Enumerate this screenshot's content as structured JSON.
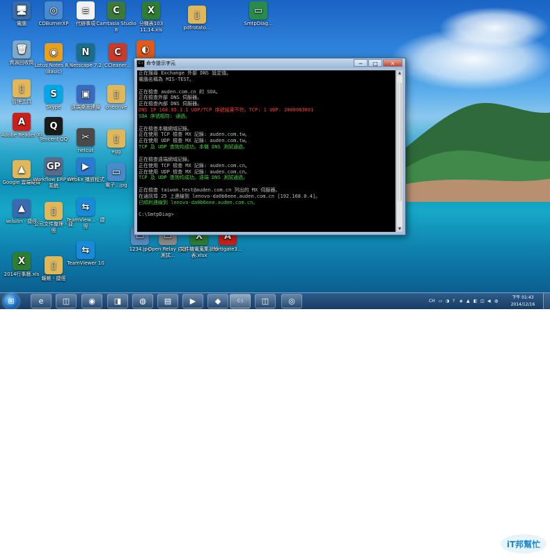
{
  "desktop": {
    "icons": [
      {
        "label": "電腦",
        "symbol": "🖥",
        "bg": "#3b6ea8"
      },
      {
        "label": "CDBurnerXP",
        "symbol": "◎",
        "bg": "#4a8bd0"
      },
      {
        "label": "代辦事項",
        "symbol": "≡",
        "bg": "#f2f2f2"
      },
      {
        "label": "Camtasia Studio 8",
        "symbol": "C",
        "bg": "#3c7a3c"
      },
      {
        "label": "分機表103 11.14.xls",
        "symbol": "X",
        "bg": "#2e7d32"
      },
      {
        "label": "pdfrotato...",
        "symbol": "▯",
        "bg": "#e0b85a"
      },
      {
        "label": "SmtpDiag...",
        "symbol": "▭",
        "bg": "#2a8a4a"
      },
      {
        "label": "資源回收筒",
        "symbol": "🗑",
        "bg": "#7fa8c8"
      },
      {
        "label": "Lotus Notes 8.5 (Basic)",
        "symbol": "◉",
        "bg": "#e8a020"
      },
      {
        "label": "Netscape 7.2",
        "symbol": "N",
        "bg": "#1b6e8a"
      },
      {
        "label": "CCleaner...",
        "symbol": "C",
        "bg": "#c83a2a"
      },
      {
        "label": "Sp...",
        "symbol": "◐",
        "bg": "#e05a1a"
      },
      {
        "label": "管理工具",
        "symbol": "▯",
        "bg": "#e0b85a"
      },
      {
        "label": "Skype",
        "symbol": "S",
        "bg": "#00a8e8"
      },
      {
        "label": "遠端桌面連線",
        "symbol": "▣",
        "bg": "#3a6ac0"
      },
      {
        "label": "onedrive",
        "symbol": "▯",
        "bg": "#e0b85a"
      },
      {
        "label": "Adobe Reader XI",
        "symbol": "A",
        "bg": "#c8201a"
      },
      {
        "label": "Tencent QQ",
        "symbol": "Q",
        "bg": "#1a1a1a"
      },
      {
        "label": "netcut",
        "symbol": "✂",
        "bg": "#4a4a4a"
      },
      {
        "label": "egg",
        "symbol": "▯",
        "bg": "#e0b85a"
      },
      {
        "label": "Google 雲端硬碟",
        "symbol": "▲",
        "bg": "#e0b85a"
      },
      {
        "label": "Workflow ERP GP 系統",
        "symbol": "GP",
        "bg": "#5a6a8a"
      },
      {
        "label": "WebEx 播放程式",
        "symbol": "▶",
        "bg": "#2a7ad0"
      },
      {
        "label": "電子...jpg",
        "symbol": "▭",
        "bg": "#4a8ac8"
      },
      {
        "label": "wilsilin - 捷徑",
        "symbol": "▲",
        "bg": "#3a6ab0"
      },
      {
        "label": "公司文件整理 - 捷徑",
        "symbol": "▯",
        "bg": "#e0b85a"
      },
      {
        "label": "TeamView... - 捷徑",
        "symbol": "⇆",
        "bg": "#1a8ad8"
      },
      {
        "label": "1234.jpg",
        "symbol": "▭",
        "bg": "#5a8ac0"
      },
      {
        "label": "Open Relay 自動測試...",
        "symbol": "▭",
        "bg": "#8a8a8a"
      },
      {
        "label": "文件機電蒐集狀態表.xlsx",
        "symbol": "X",
        "bg": "#2e7d32"
      },
      {
        "label": "fortigate3...",
        "symbol": "A",
        "bg": "#c8201a"
      },
      {
        "label": "2014行事曆.xls",
        "symbol": "X",
        "bg": "#2e7d32"
      },
      {
        "label": "報帳 - 捷徑",
        "symbol": "▯",
        "bg": "#e0b85a"
      },
      {
        "label": "TeamViewer 10",
        "symbol": "⇆",
        "bg": "#1a8ad8"
      }
    ]
  },
  "window": {
    "icon": "C:\\",
    "title": "命令提示字元",
    "minimize": "─",
    "maximize": "□",
    "close": "✕",
    "lines": [
      {
        "t": "正在搜尋 Exchange 外部 DNS 設定值。",
        "c": "gray"
      },
      {
        "t": "電腦名稱為 MIS-TEST。",
        "c": "gray"
      },
      {
        "t": "",
        "c": "gray"
      },
      {
        "t": "正在檢查 auden.com.cn 的 SOA。",
        "c": "gray"
      },
      {
        "t": "正在檢查外部 DNS 伺服器。",
        "c": "gray"
      },
      {
        "t": "正在檢查內部 DNS 伺服器。",
        "c": "gray"
      },
      {
        "t": "DNS IP 168.95.1.1 UDP/TCP 序號結果不符。TCP: 1 UDP: 2008083001",
        "c": "red"
      },
      {
        "t": "SOA 序號相符: 通過。",
        "c": "green"
      },
      {
        "t": "",
        "c": "gray"
      },
      {
        "t": "正在檢查本機網域記錄。",
        "c": "gray"
      },
      {
        "t": "正在使用 TCP 檢查 MX 記錄: auden.com.tw。",
        "c": "gray"
      },
      {
        "t": "正在使用 UDP 檢查 MX 記錄: auden.com.tw。",
        "c": "gray"
      },
      {
        "t": "TCP 及 UDP 查詢均成功。本機 DNS 測試通過。",
        "c": "green"
      },
      {
        "t": "",
        "c": "gray"
      },
      {
        "t": "正在檢查遠端網域記錄。",
        "c": "gray"
      },
      {
        "t": "正在使用 TCP 檢查 MX 記錄: auden.com.cn。",
        "c": "gray"
      },
      {
        "t": "正在使用 UDP 檢查 MX 記錄: auden.com.cn。",
        "c": "gray"
      },
      {
        "t": "TCP 及 UDP 查詢均成功。遠端 DNS 測試通過。",
        "c": "green"
      },
      {
        "t": "",
        "c": "gray"
      },
      {
        "t": "正在檢查 taiwan.test@auden.com.cn 列出的 MX 伺服器。",
        "c": "gray"
      },
      {
        "t": "在通訊埠 25 上連線到 lenovo-da0b6eee.auden.com.cn [192.168.0.4]。",
        "c": "gray"
      },
      {
        "t": "已順利連線到 lenovo-da0b6eee.auden.com.cn。",
        "c": "green"
      },
      {
        "t": "",
        "c": "gray"
      },
      {
        "t": "C:\\SmtpDiag>",
        "c": "gray"
      }
    ]
  },
  "taskbar": {
    "start_symbol": "⊞",
    "buttons": [
      "e",
      "◫",
      "◉",
      "◨",
      "◍",
      "▤",
      "▶",
      "◆",
      "C:\\",
      "◫",
      "◎"
    ],
    "tray": {
      "lang": "CH",
      "icons": [
        "▭",
        "◑",
        "?",
        "◈",
        "▲",
        "◧",
        "◫",
        "◀",
        "◍"
      ]
    },
    "time": "下午 01:43",
    "date": "2014/12/16"
  },
  "watermark": {
    "text": "iT邦幫忙"
  }
}
